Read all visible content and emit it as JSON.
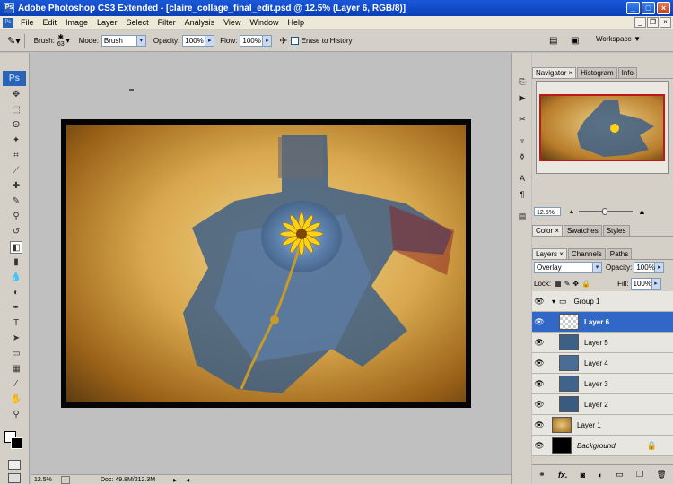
{
  "title": "Adobe Photoshop CS3 Extended - [claire_collage_final_edit.psd @ 12.5% (Layer 6, RGB/8)]",
  "menu": [
    "File",
    "Edit",
    "Image",
    "Layer",
    "Select",
    "Filter",
    "Analysis",
    "View",
    "Window",
    "Help"
  ],
  "options": {
    "brush_label": "Brush:",
    "brush_size": "63",
    "mode_label": "Mode:",
    "mode_value": "Brush",
    "opacity_label": "Opacity:",
    "opacity_value": "100%",
    "flow_label": "Flow:",
    "flow_value": "100%",
    "erase_history": "Erase to History",
    "workspace": "Workspace ▼"
  },
  "status": {
    "zoom": "12.5%",
    "doc": "Doc: 49.8M/212.3M"
  },
  "navigator": {
    "tabs": [
      "Navigator",
      "Histogram",
      "Info"
    ],
    "zoom": "12.5%"
  },
  "color_tabs": [
    "Color",
    "Swatches",
    "Styles"
  ],
  "layers_panel": {
    "tabs": [
      "Layers",
      "Channels",
      "Paths"
    ],
    "blend_mode": "Overlay",
    "opacity_label": "Opacity:",
    "opacity_value": "100%",
    "lock_label": "Lock:",
    "fill_label": "Fill:",
    "fill_value": "100%",
    "layers": [
      {
        "name": "Group 1",
        "type": "group"
      },
      {
        "name": "Layer 6",
        "type": "layer",
        "selected": true
      },
      {
        "name": "Layer 5",
        "type": "layer"
      },
      {
        "name": "Layer 4",
        "type": "layer"
      },
      {
        "name": "Layer 3",
        "type": "layer"
      },
      {
        "name": "Layer 2",
        "type": "layer"
      },
      {
        "name": "Layer 1",
        "type": "layer"
      },
      {
        "name": "Background",
        "type": "background"
      }
    ]
  },
  "colors": {
    "title_blue": "#0b3fb8",
    "selected_layer": "#3168c7",
    "ps_blue": "#2a63b5"
  }
}
